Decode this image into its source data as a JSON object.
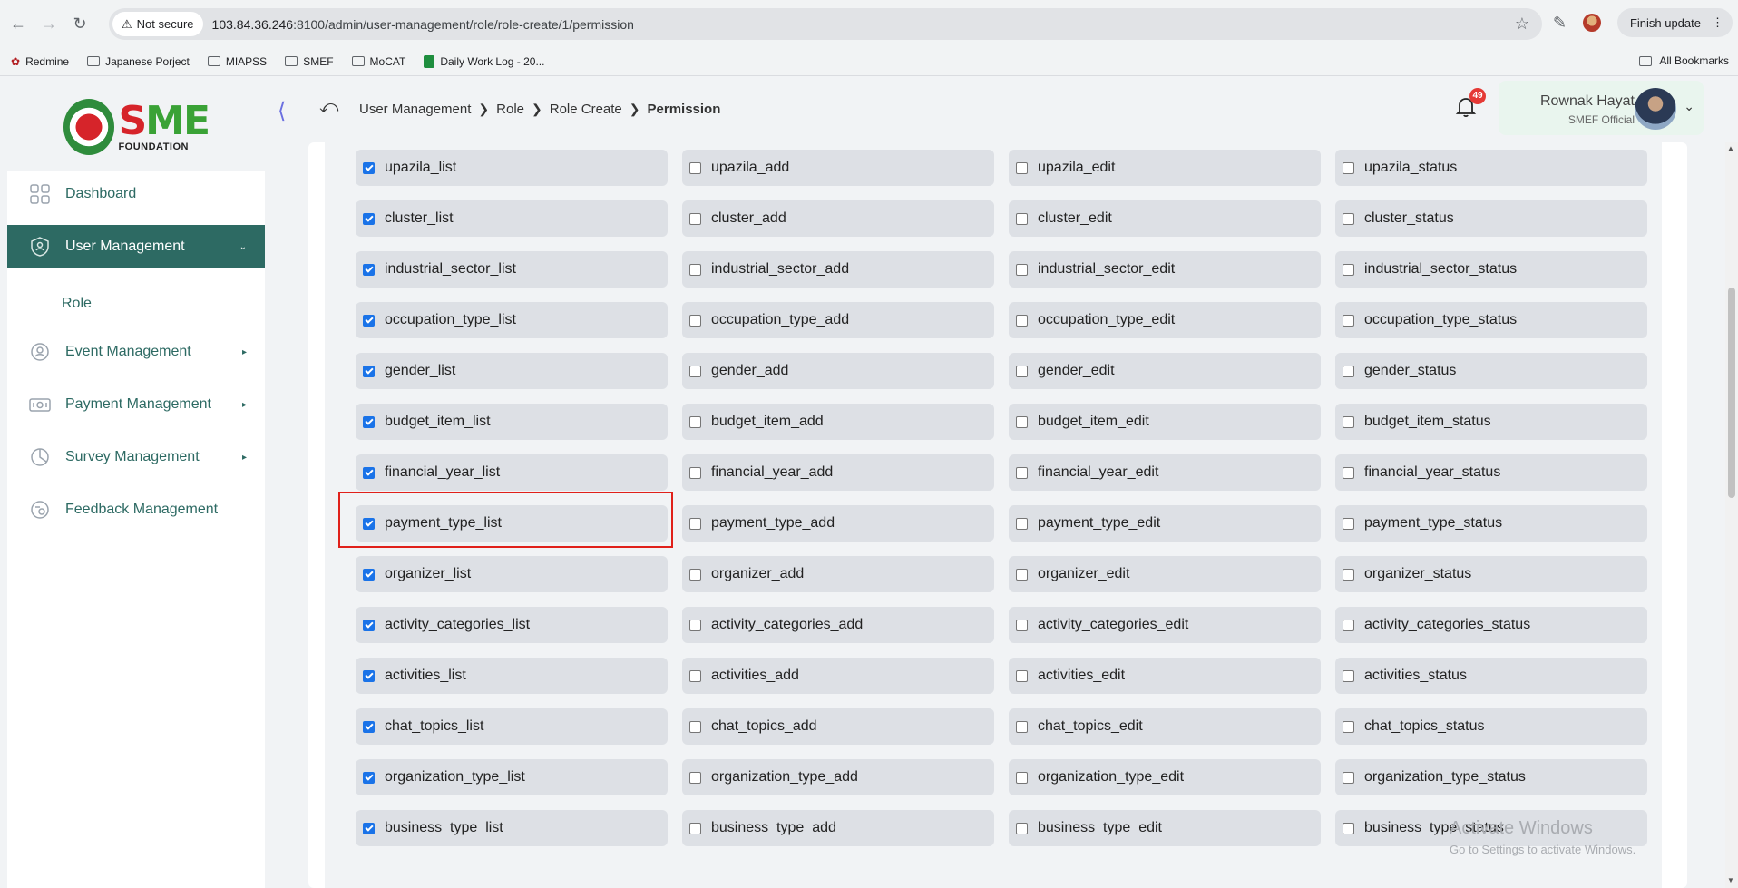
{
  "browser": {
    "security_label": "Not secure",
    "url_host": "103.84.36.246",
    "url_rest": ":8100/admin/user-management/role/role-create/1/permission",
    "finish_update": "Finish update",
    "bookmarks": [
      "Redmine",
      "Japanese Porject",
      "MIAPSS",
      "SMEF",
      "MoCAT",
      "Daily Work Log - 20..."
    ],
    "all_bookmarks": "All Bookmarks"
  },
  "logo": {
    "brand": "SME",
    "tagline": "FOUNDATION"
  },
  "sidebar": {
    "items": [
      {
        "label": "Dashboard"
      },
      {
        "label": "User Management"
      },
      {
        "label": "Event Management"
      },
      {
        "label": "Payment Management"
      },
      {
        "label": "Survey Management"
      },
      {
        "label": "Feedback Management"
      }
    ],
    "sub_item": "Role"
  },
  "breadcrumb": {
    "items": [
      "User Management",
      "Role",
      "Role Create"
    ],
    "current": "Permission"
  },
  "notifications": {
    "count": "49"
  },
  "user": {
    "name": "Rownak Hayat",
    "role": "SMEF Official"
  },
  "permissions": [
    [
      "upazila_list",
      "upazila_add",
      "upazila_edit",
      "upazila_status"
    ],
    [
      "cluster_list",
      "cluster_add",
      "cluster_edit",
      "cluster_status"
    ],
    [
      "industrial_sector_list",
      "industrial_sector_add",
      "industrial_sector_edit",
      "industrial_sector_status"
    ],
    [
      "occupation_type_list",
      "occupation_type_add",
      "occupation_type_edit",
      "occupation_type_status"
    ],
    [
      "gender_list",
      "gender_add",
      "gender_edit",
      "gender_status"
    ],
    [
      "budget_item_list",
      "budget_item_add",
      "budget_item_edit",
      "budget_item_status"
    ],
    [
      "financial_year_list",
      "financial_year_add",
      "financial_year_edit",
      "financial_year_status"
    ],
    [
      "payment_type_list",
      "payment_type_add",
      "payment_type_edit",
      "payment_type_status"
    ],
    [
      "organizer_list",
      "organizer_add",
      "organizer_edit",
      "organizer_status"
    ],
    [
      "activity_categories_list",
      "activity_categories_add",
      "activity_categories_edit",
      "activity_categories_status"
    ],
    [
      "activities_list",
      "activities_add",
      "activities_edit",
      "activities_status"
    ],
    [
      "chat_topics_list",
      "chat_topics_add",
      "chat_topics_edit",
      "chat_topics_status"
    ],
    [
      "organization_type_list",
      "organization_type_add",
      "organization_type_edit",
      "organization_type_status"
    ],
    [
      "business_type_list",
      "business_type_add",
      "business_type_edit",
      "business_type_status"
    ]
  ],
  "activate_windows": {
    "title": "Activate Windows",
    "subtitle": "Go to Settings to activate Windows."
  },
  "colors": {
    "accent": "#2d6a63",
    "highlight": "#e0201a",
    "checkbox": "#1a73e8"
  }
}
